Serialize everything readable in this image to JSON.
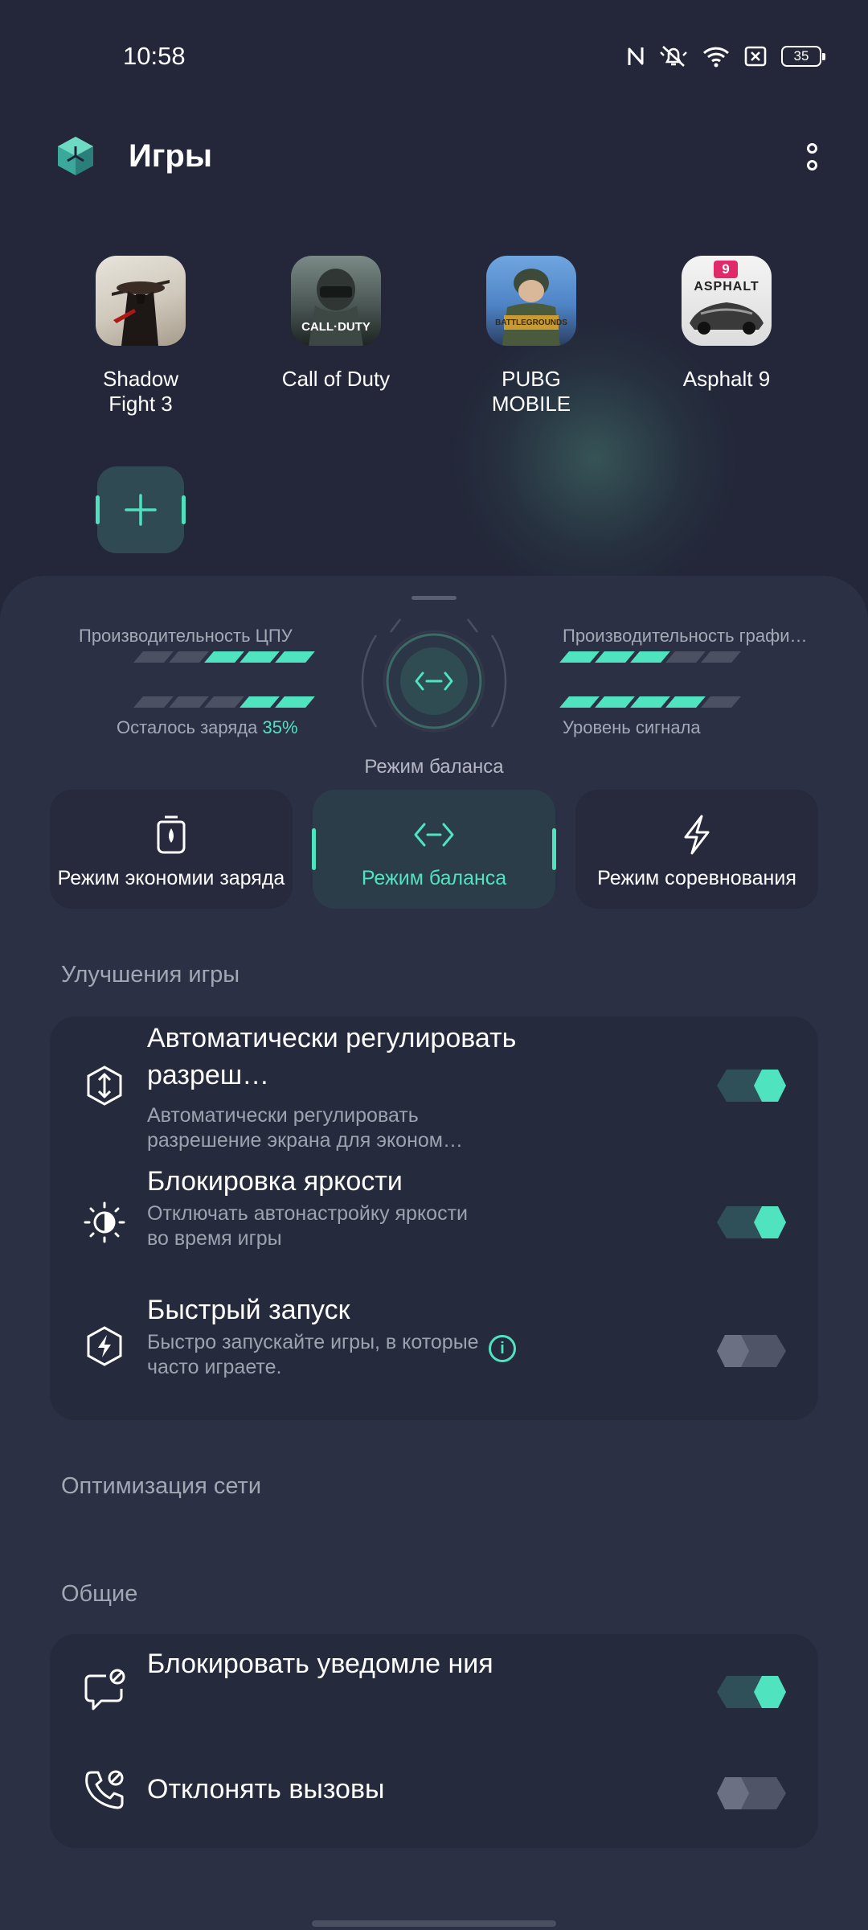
{
  "status": {
    "time": "10:58",
    "battery": "35"
  },
  "header": {
    "title": "Игры"
  },
  "games": [
    {
      "name": "Shadow\nFight 3",
      "icon": "shadow-fight-3-icon"
    },
    {
      "name": "Call of Duty",
      "icon": "call-of-duty-icon",
      "icon_text": "CALL·DUTY"
    },
    {
      "name": "PUBG\nMOBILE",
      "icon": "pubg-mobile-icon",
      "icon_text": "BATTLEGROUNDS"
    },
    {
      "name": "Asphalt 9",
      "icon": "asphalt-9-icon",
      "icon_text": "ASPHALT",
      "icon_badge": "9"
    }
  ],
  "performance": {
    "cpu_label": "Производительность ЦПУ",
    "cpu_level": 3,
    "gpu_label": "Производительность графи…",
    "gpu_level": 3,
    "battery_label": "Осталось заряда",
    "battery_value": "35%",
    "battery_level": 2,
    "signal_label": "Уровень сигнала",
    "signal_level": 4,
    "bar_count": 5,
    "current_mode": "Режим баланса"
  },
  "modes": [
    {
      "label": "Режим экономии заряда",
      "icon": "battery-saver-icon",
      "active": false
    },
    {
      "label": "Режим баланса",
      "icon": "balance-icon",
      "active": true
    },
    {
      "label": "Режим соревнования",
      "icon": "lightning-icon",
      "active": false
    }
  ],
  "sections": {
    "enhancements": "Улучшения игры",
    "network": "Оптимизация сети",
    "general": "Общие"
  },
  "enhancements": [
    {
      "title": "Автоматически регулировать разреш…",
      "subtitle": "Автоматически регулировать разрешение экрана для эконом…",
      "enabled": true
    },
    {
      "title": "Блокировка яркости",
      "subtitle": "Отключать автонастройку яркости во время игры",
      "enabled": true
    },
    {
      "title": "Быстрый запуск",
      "subtitle": "Быстро запускайте игры, в которые часто играете.",
      "enabled": false,
      "info": "i"
    }
  ],
  "general": [
    {
      "title": "Блокировать уведомле ния",
      "enabled": true
    },
    {
      "title": "Отклонять вызовы",
      "enabled": false
    }
  ],
  "colors": {
    "accent": "#4fe3c0",
    "background": "#232739",
    "panel": "#2c3044",
    "card": "#252a3c"
  }
}
